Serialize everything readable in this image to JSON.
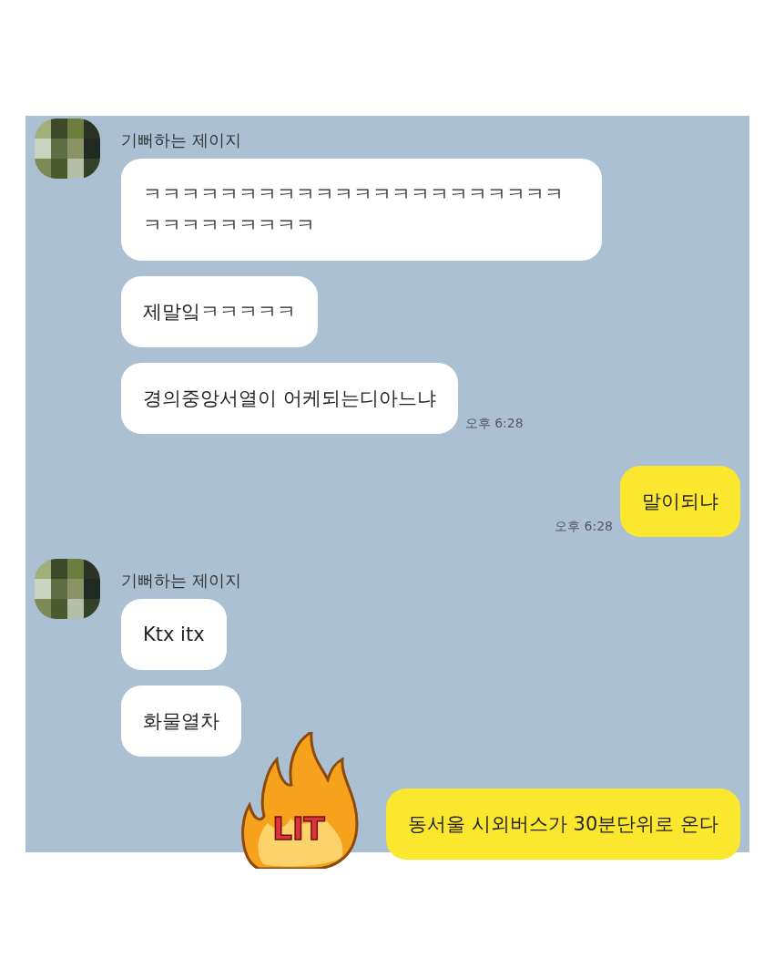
{
  "chat": [
    {
      "kind": "received",
      "sender": "기뻐하는 제이지",
      "bubbles": [
        "ㅋㅋㅋㅋㅋㅋㅋㅋㅋㅋㅋㅋㅋㅋㅋㅋㅋㅋㅋㅋㅋㅋㅋㅋㅋㅋㅋㅋㅋㅋㅋ",
        "제말잌ㅋㅋㅋㅋㅋ",
        "경의중앙서열이 어케되는디아느냐"
      ],
      "time": "오후 6:28"
    },
    {
      "kind": "sent",
      "text": "말이되냐",
      "time": "오후 6:28"
    },
    {
      "kind": "received",
      "sender": "기뻐하는 제이지",
      "bubbles": [
        "Ktx itx",
        "화물열차"
      ]
    },
    {
      "kind": "sent",
      "text": "동서울 시외버스가 30분단위로 온다",
      "sticker": {
        "text": "LIT"
      }
    }
  ]
}
